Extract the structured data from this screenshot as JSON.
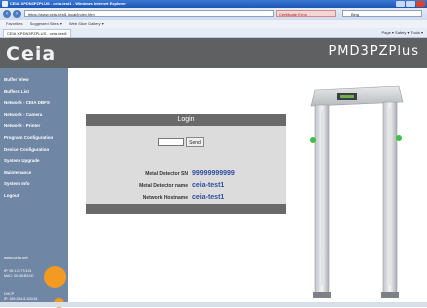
{
  "browser": {
    "window_title": "CEIA XPDN3PZPLUS - ceia-test1 - Windows Internet Explorer",
    "url": "https://www.ceia-test1.local/index.htm",
    "certificate_label": "Certificate Error",
    "search_placeholder": "Bing",
    "favorites": [
      "Favorites",
      "Suggested Sites ▾",
      "Web Slice Gallery ▾"
    ],
    "tab_title": "CEIA XPDN3PZPLUS - ceia-test1",
    "tab_tools": "Page ▾  Safety ▾  Tools ▾"
  },
  "header": {
    "logo": "Ceia",
    "product": "PMD3PZPlus"
  },
  "sidebar": {
    "items": [
      {
        "label": "Buffer View"
      },
      {
        "label": "Buffers List"
      },
      {
        "label": "Network - CEIA DBFS"
      },
      {
        "label": "Network - Camera"
      },
      {
        "label": "Network - Printer"
      },
      {
        "label": "Program Configuration"
      },
      {
        "label": "Device Configuration"
      },
      {
        "label": "System Upgrade"
      },
      {
        "label": "Maintenance"
      },
      {
        "label": "System Info"
      },
      {
        "label": "Logout"
      }
    ],
    "footer_url": "www.ceia.net",
    "ip_info": "IP: 95.1.0.77/124\nMAC: 00:06:B3:00",
    "ip_info2": "DHCP\nIP: 169.254.6.100/16"
  },
  "login": {
    "title": "Login",
    "password_value": "",
    "send_label": "Send",
    "rows": [
      {
        "label": "Metal Detector SN",
        "value": "99999999999"
      },
      {
        "label": "Metal Detector name",
        "value": "ceia-test1"
      },
      {
        "label": "Network Hostname",
        "value": "ceia-test1"
      }
    ]
  },
  "colors": {
    "header_bg": "#5f6062",
    "sidebar_bg": "#6f86a4",
    "accent_orange": "#f29a22",
    "value_blue": "#2f4fa0"
  }
}
